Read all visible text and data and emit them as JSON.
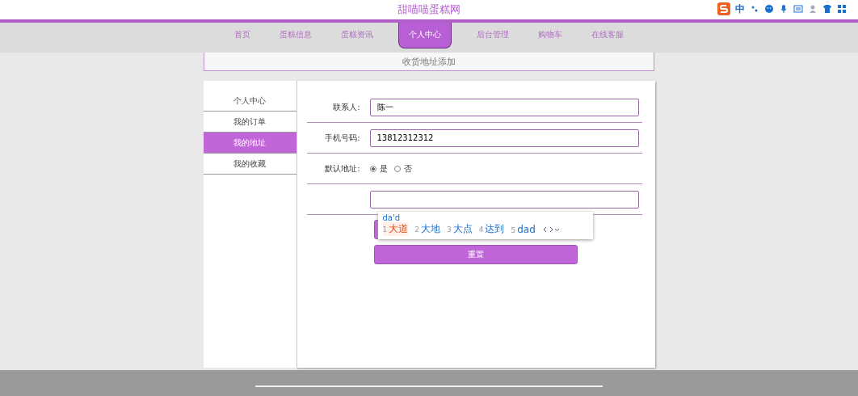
{
  "site_title": "甜喵喵蛋糕网",
  "nav": [
    {
      "label": "首页",
      "selected": false
    },
    {
      "label": "蛋糕信息",
      "selected": false
    },
    {
      "label": "蛋糕资讯",
      "selected": false
    },
    {
      "label": "个人中心",
      "selected": true
    },
    {
      "label": "后台管理",
      "selected": false
    },
    {
      "label": "购物车",
      "selected": false
    },
    {
      "label": "在线客服",
      "selected": false
    }
  ],
  "page_heading": "收货地址添加",
  "sidebar": [
    {
      "label": "个人中心",
      "selected": false
    },
    {
      "label": "我的订单",
      "selected": false
    },
    {
      "label": "我的地址",
      "selected": true
    },
    {
      "label": "我的收藏",
      "selected": false
    }
  ],
  "form": {
    "fields": [
      {
        "kind": "text",
        "label": "联系人:",
        "value": "陈一"
      },
      {
        "kind": "text",
        "label": "手机号码:",
        "value": "13812312312"
      },
      {
        "kind": "radio",
        "label": "默认地址:",
        "options": [
          {
            "label": "是",
            "selected": true
          },
          {
            "label": "否",
            "selected": false
          }
        ]
      },
      {
        "kind": "text"
      }
    ],
    "buttons": [
      {
        "kind": "submit"
      },
      {
        "kind": "reset",
        "label": "重置"
      }
    ]
  },
  "ime": {
    "composition": "da'd",
    "candidates": [
      {
        "index": "1",
        "text": "大道",
        "selected": true
      },
      {
        "index": "2",
        "text": "大地",
        "selected": false
      },
      {
        "index": "3",
        "text": "大点",
        "selected": false
      },
      {
        "index": "4",
        "text": "达到",
        "selected": false
      },
      {
        "index": "5",
        "text": "dad",
        "selected": false
      }
    ],
    "status": "中"
  }
}
